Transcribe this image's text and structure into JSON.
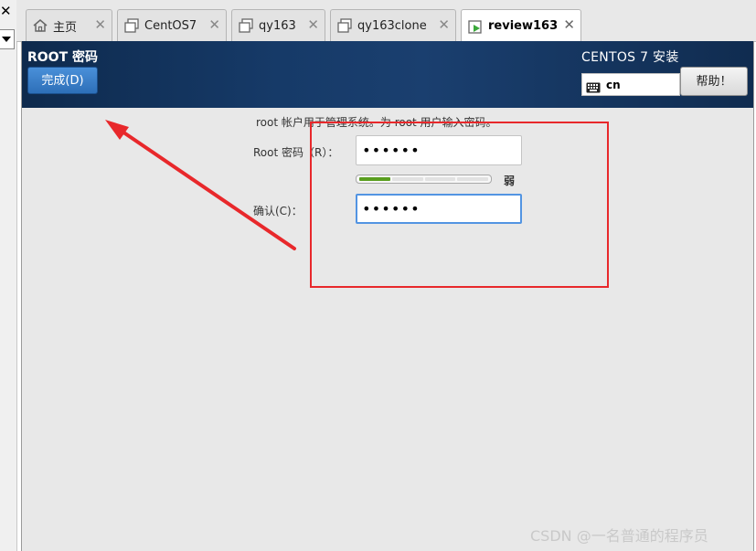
{
  "left_panel": {
    "close_glyph": "✕"
  },
  "tabs": [
    {
      "label": "主页",
      "icon": "home-icon",
      "active": false
    },
    {
      "label": "CentOS7",
      "icon": "vm-icon",
      "active": false
    },
    {
      "label": "qy163",
      "icon": "vm-icon",
      "active": false
    },
    {
      "label": "qy163clone",
      "icon": "vm-icon",
      "active": false
    },
    {
      "label": "review163",
      "icon": "vm-running-icon",
      "active": true
    }
  ],
  "tab_close_glyph": "✕",
  "installer": {
    "page_title": "ROOT 密码",
    "done_button": "完成(D)",
    "install_title": "CENTOS 7 安装",
    "keyboard_layout": "cn",
    "help_button": "帮助！",
    "instruction": "root 帐户用于管理系统。为 root 用户输入密码。",
    "root_password_label": "Root 密码（R）：",
    "root_password_value": "••••••",
    "confirm_label": "确认(C)：",
    "confirm_value": "••••••",
    "strength_text": "弱",
    "strength_segments_total": 4,
    "strength_segments_filled": 1
  },
  "colors": {
    "header_bg": "#163a68",
    "done_button": "#3a80cc",
    "annotation_red": "#e8282b",
    "strength_green": "#5a9e1f",
    "focus_blue": "#5294e2"
  },
  "watermark": "CSDN @一名普通的程序员"
}
